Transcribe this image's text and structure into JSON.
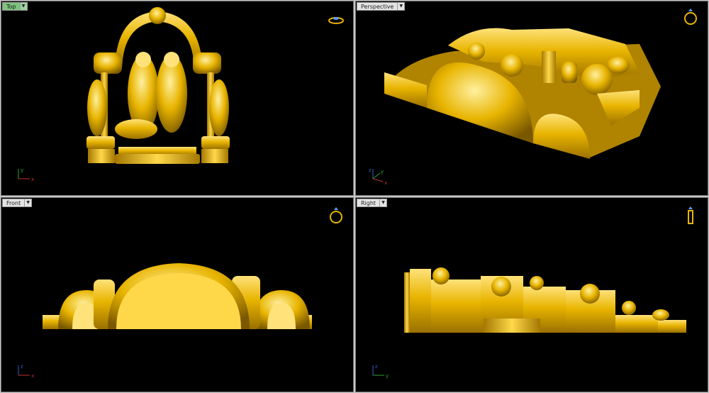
{
  "viewports": {
    "top": {
      "label": "Top",
      "active": true,
      "axes": [
        "y",
        "x"
      ]
    },
    "perspective": {
      "label": "Perspective",
      "active": false,
      "axes": [
        "z",
        "y",
        "x"
      ]
    },
    "front": {
      "label": "Front",
      "active": false,
      "axes": [
        "z",
        "x"
      ]
    },
    "right": {
      "label": "Right",
      "active": false,
      "axes": [
        "z",
        "y"
      ]
    }
  },
  "icons": {
    "view_cube": "ring-icon",
    "dropdown": "chevron-down-icon"
  },
  "colors": {
    "viewport_bg": "#000000",
    "gold": "#e8b400",
    "gold_light": "#ffd84a",
    "gold_dark": "#8a6400",
    "active_tab": "#7fc37f",
    "axis_x": "#c03030",
    "axis_y": "#30a030",
    "axis_z": "#3060c0"
  }
}
